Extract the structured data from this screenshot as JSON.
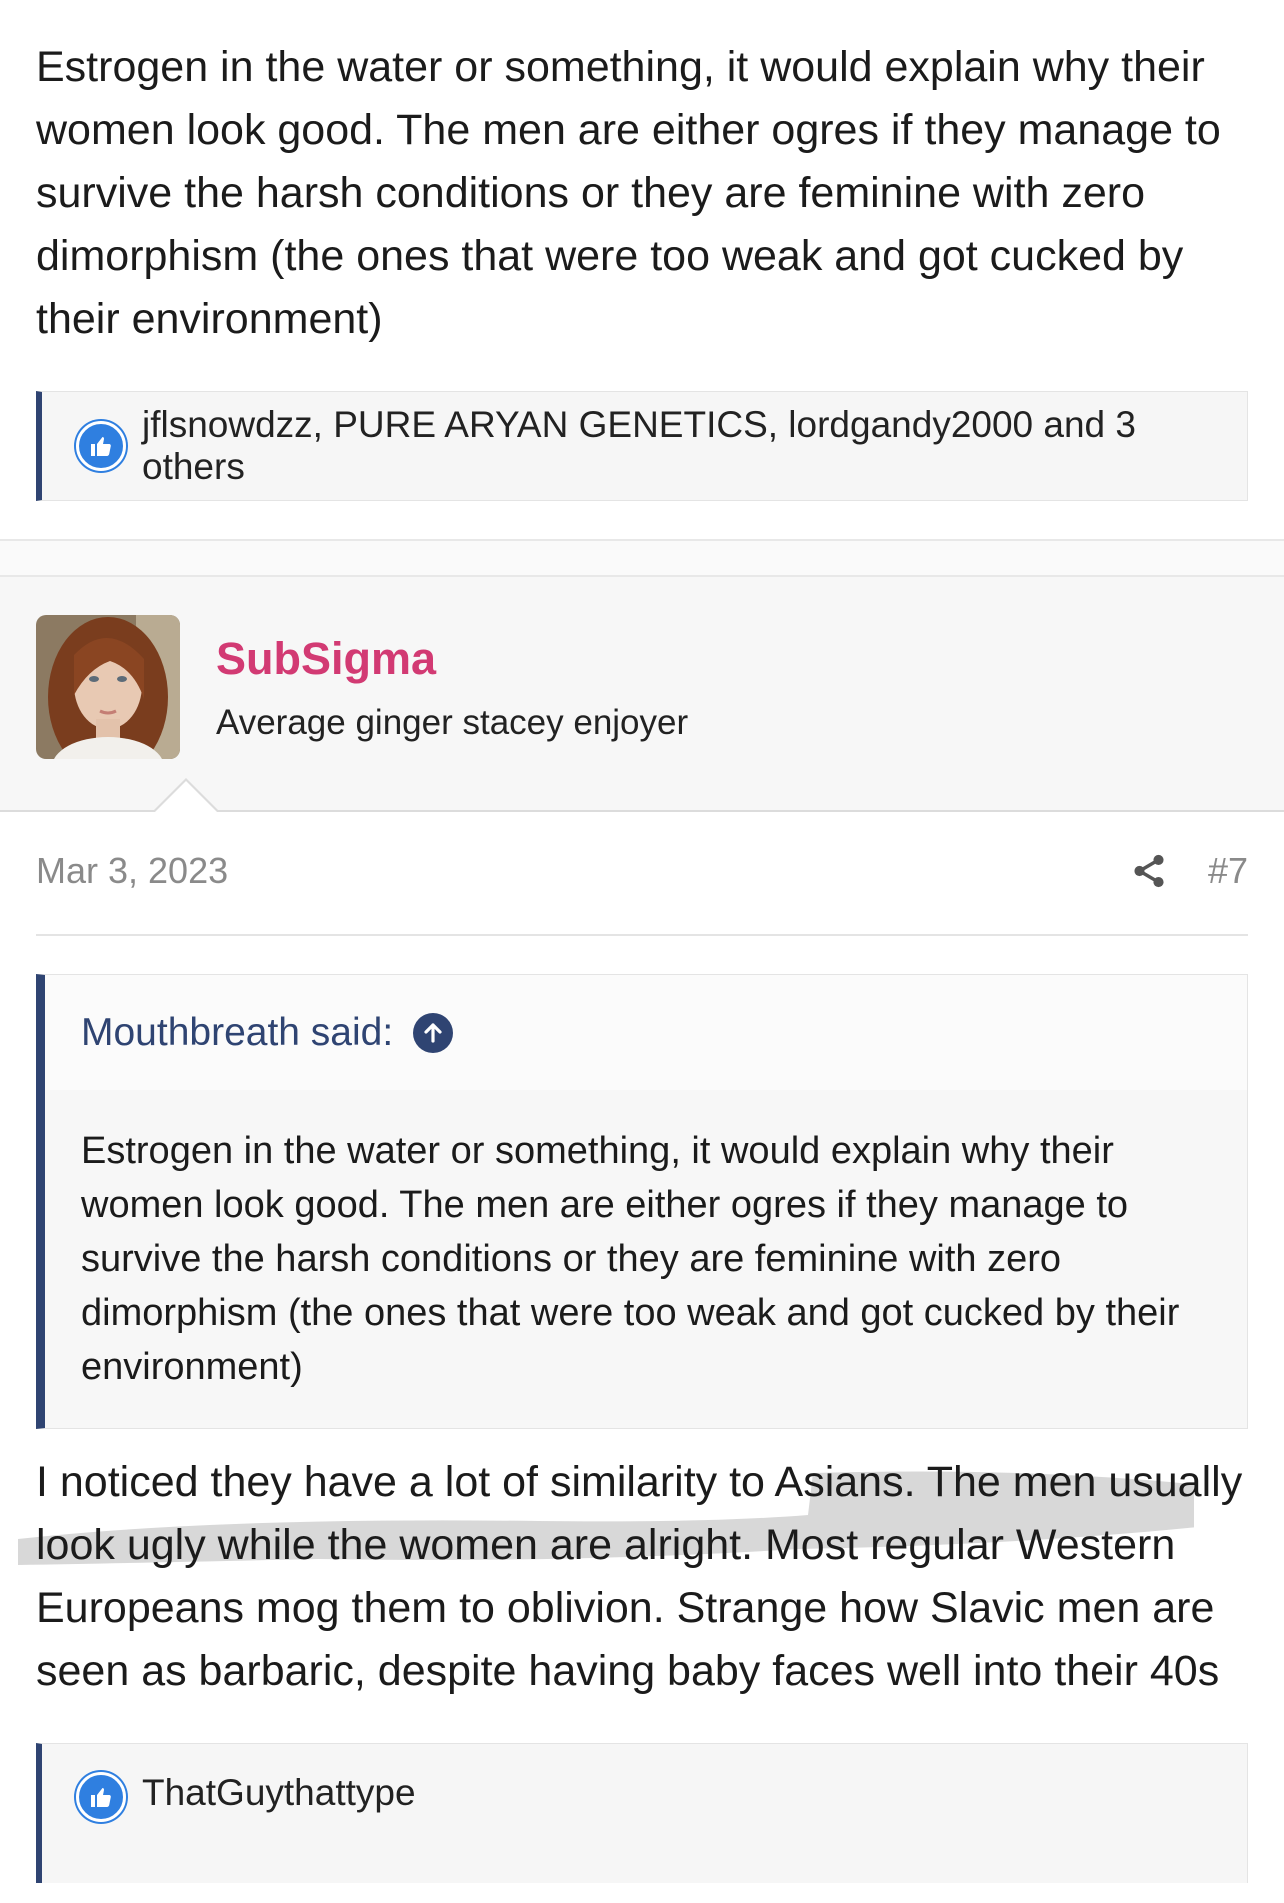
{
  "previous_post": {
    "body": "Estrogen in the water or something, it would explain why their women look good. The men are either ogres if they manage to survive the harsh conditions or they are feminine with zero dimorphism (the ones that were too weak and got cucked by their environment)",
    "reactions_text": "jflsnowdzz, PURE ARYAN GENETICS, lordgandy2000 and 3 others",
    "reaction_icon": "like-icon"
  },
  "post": {
    "username": "SubSigma",
    "user_title": "Average ginger stacey enjoyer",
    "date": "Mar 3, 2023",
    "post_number": "#7",
    "quote": {
      "author": "Mouthbreath said:",
      "text": "Estrogen in the water or something, it would explain why their women look good. The men are either ogres if they manage to survive the harsh conditions or they are feminine with zero dimorphism (the ones that were too weak and got cucked by their environment)"
    },
    "body": "I noticed they have a lot of similarity to Asians. The men usually look ugly while the women are alright. Most regular Western Europeans mog them to oblivion. Strange how Slavic men are seen as barbaric, despite having baby faces well into their 40s",
    "reactions_text": "ThatGuythattype"
  },
  "colors": {
    "username": "#d23a73",
    "accent": "#2f4472",
    "like": "#2f7fe0"
  }
}
